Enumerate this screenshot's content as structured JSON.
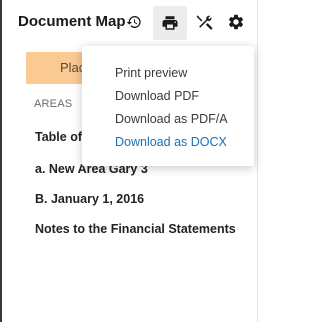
{
  "header": {
    "title": "Document Map"
  },
  "toolbar": {
    "icons": [
      "history-icon",
      "print-icon",
      "tools-icon",
      "gear-icon"
    ]
  },
  "place_button": {
    "label": "Plac"
  },
  "areas": {
    "heading": "AREAS",
    "items": [
      "Table of C",
      "a.  New Area Gary 3",
      "B.  January 1, 2016",
      "Notes to the Financial Statements"
    ]
  },
  "print_menu": {
    "items": [
      "Print preview",
      "Download PDF",
      "Download as PDF/A",
      "Download as DOCX"
    ],
    "highlight_color": "#1b6fb8"
  },
  "colors": {
    "place_button_bg": "#fbc992",
    "active_icon_bg": "#ececec"
  }
}
